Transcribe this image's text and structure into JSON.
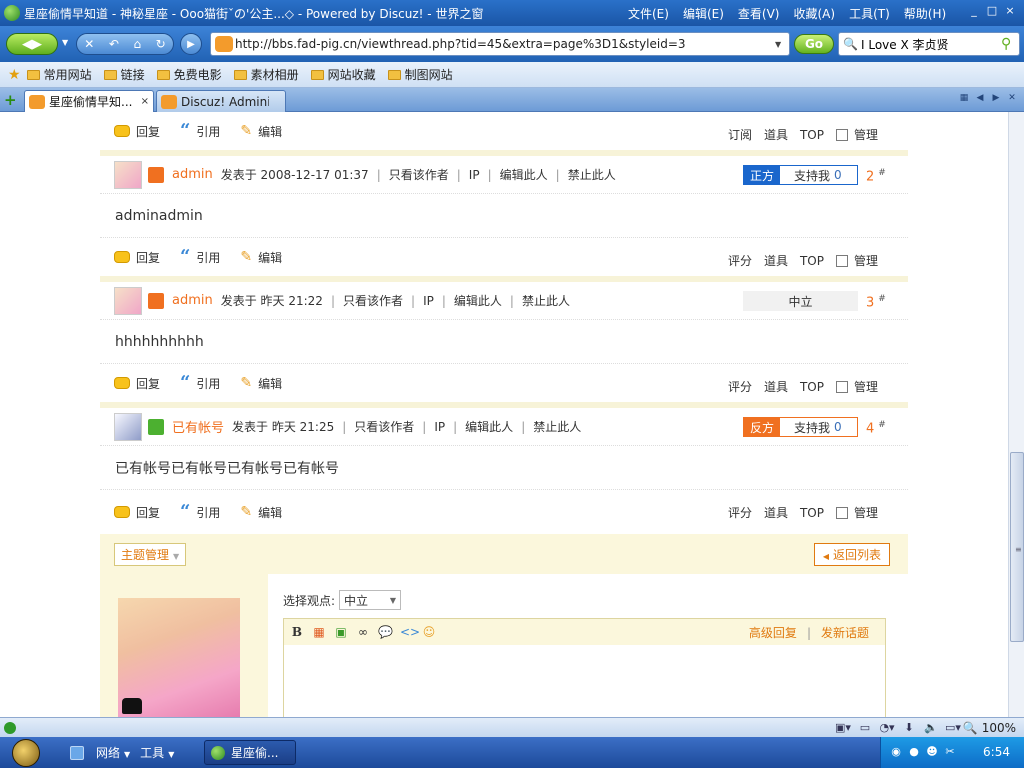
{
  "window": {
    "title": "星座偷情早知道 - 神秘星座 - Ooo猫街ˇの'公主...◇ - Powered by Discuz! - 世界之窗",
    "menus": [
      "文件(E)",
      "编辑(E)",
      "查看(V)",
      "收藏(A)",
      "工具(T)",
      "帮助(H)"
    ],
    "controls": [
      "_",
      "□",
      "×"
    ]
  },
  "navbar": {
    "url": "http://bbs.fad-pig.cn/viewthread.php?tid=45&extra=page%3D1&styleid=3",
    "go_label": "Go",
    "search_value": "I Love X 李贞贤"
  },
  "bookmarks": [
    "常用网站",
    "链接",
    "免费电影",
    "素材相册",
    "网站收藏",
    "制图网站"
  ],
  "tabs": [
    {
      "label": "星座偷情早知...",
      "close": "×"
    },
    {
      "label": "Discuz! Administ..."
    }
  ],
  "actions": {
    "reply": "回复",
    "quote": "引用",
    "edit": "编辑",
    "subscribe": "订阅",
    "rate": "评分",
    "tools": "道具",
    "top": "TOP",
    "manage": "管理"
  },
  "posts": [
    {
      "author": "admin",
      "posted_at": "发表于 2008-12-17 01:37",
      "only_author": "只看该作者",
      "ip": "IP",
      "edit_user": "编辑此人",
      "ban_user": "禁止此人",
      "side": "正方",
      "support_label": "支持我",
      "support_count": "0",
      "floor": "2",
      "floor_mark": "#",
      "body": "adminadmin"
    },
    {
      "author": "admin",
      "posted_at": "发表于 昨天 21:22",
      "only_author": "只看该作者",
      "ip": "IP",
      "edit_user": "编辑此人",
      "ban_user": "禁止此人",
      "side": "中立",
      "floor": "3",
      "floor_mark": "#",
      "body": "hhhhhhhhhh"
    },
    {
      "author": "已有帐号",
      "posted_at": "发表于 昨天 21:25",
      "only_author": "只看该作者",
      "ip": "IP",
      "edit_user": "编辑此人",
      "ban_user": "禁止此人",
      "side": "反方",
      "support_label": "支持我",
      "support_count": "0",
      "floor": "4",
      "floor_mark": "#",
      "body": "已有帐号已有帐号已有帐号已有帐号"
    }
  ],
  "admin": {
    "topic_manage": "主题管理",
    "back_to_list": "返回列表"
  },
  "reply_form": {
    "view_label": "选择观点:",
    "view_value": "中立",
    "advanced_reply": "高级回复",
    "new_topic": "发新话题"
  },
  "statusbar": {
    "zoom": "100%"
  },
  "taskbar": {
    "network": "网络",
    "tools": "工具",
    "task_label": "星座偷...",
    "clock": "6:54"
  }
}
